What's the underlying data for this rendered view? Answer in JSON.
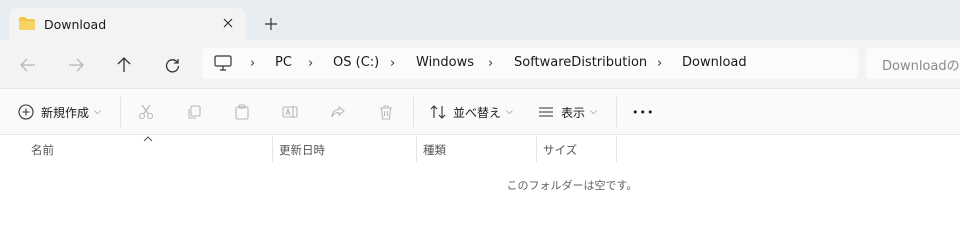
{
  "tab": {
    "title": "Download",
    "icon": "folder-icon",
    "close_icon": "close-icon"
  },
  "new_tab_icon": "plus-icon",
  "nav": {
    "back_icon": "back-arrow-icon",
    "forward_icon": "forward-arrow-icon",
    "up_icon": "up-arrow-icon",
    "refresh_icon": "refresh-icon"
  },
  "address": {
    "root_icon": "computer-icon",
    "crumbs": [
      "PC",
      "OS (C:)",
      "Windows",
      "SoftwareDistribution",
      "Download"
    ],
    "separator": "›"
  },
  "search": {
    "placeholder": "Downloadの検"
  },
  "commands": {
    "new_label": "新規作成",
    "sort_label": "並べ替え",
    "view_label": "表示",
    "more_label": "•••"
  },
  "columns": [
    "名前",
    "更新日時",
    "種類",
    "サイズ"
  ],
  "empty_message": "このフォルダーは空です。",
  "colors": {
    "tabstrip": "#e8edf1",
    "navbar": "#f3f3f3",
    "folder": "#f3c647"
  }
}
